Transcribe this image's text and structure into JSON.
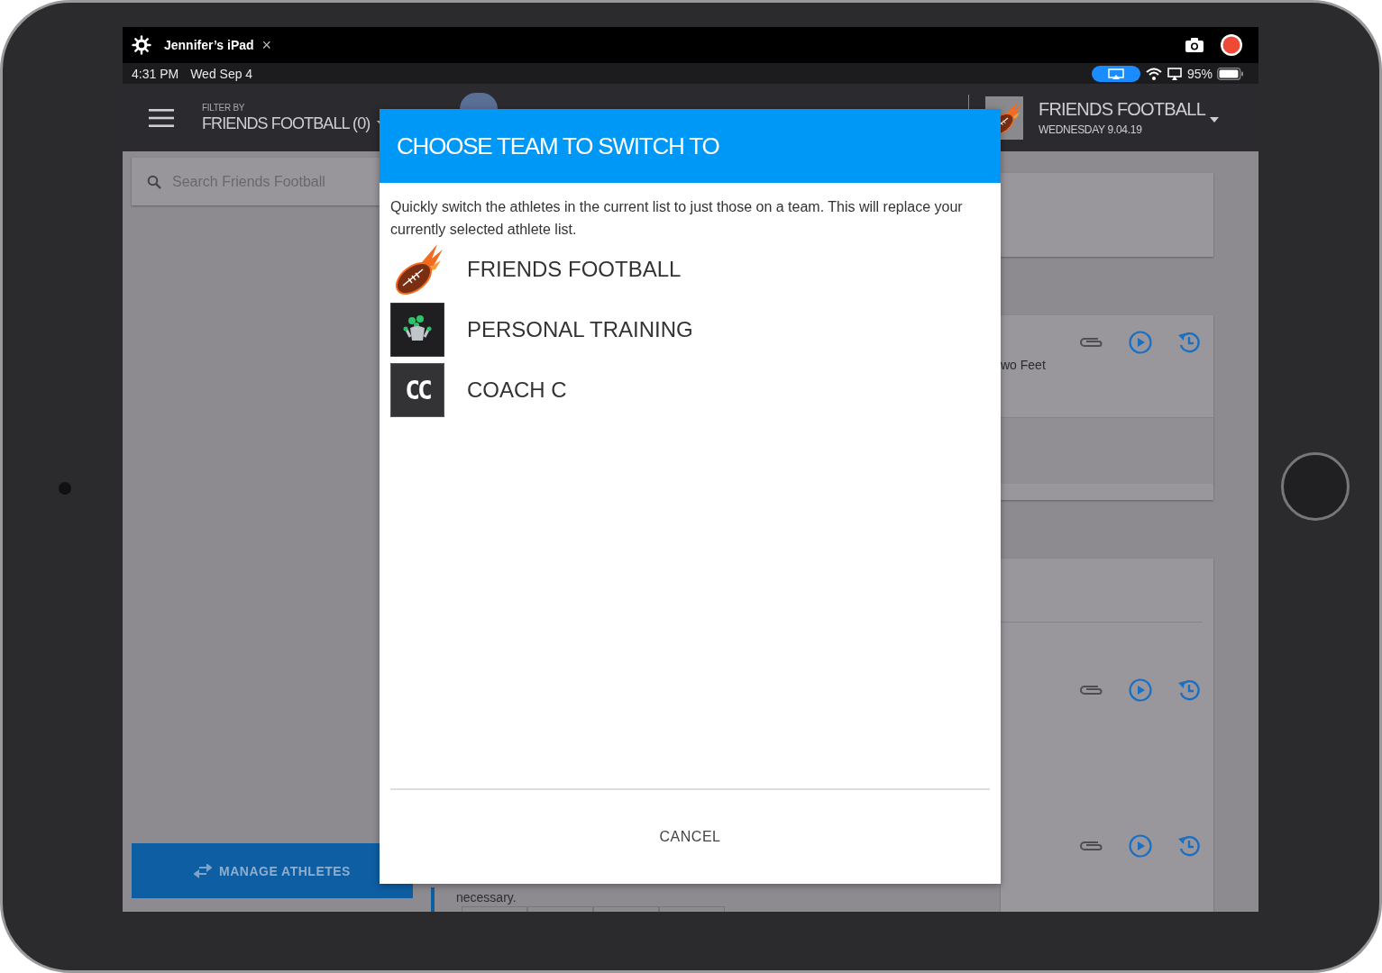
{
  "mirror_bar": {
    "device_name": "Jennifer’s iPad",
    "close": "×"
  },
  "status_bar": {
    "time": "4:31 PM",
    "date": "Wed Sep 4",
    "battery": "95%"
  },
  "app_header": {
    "filter_label": "FILTER BY",
    "filter_value": "FRIENDS FOOTBALL (0)",
    "team_name": "FRIENDS FOOTBALL",
    "date": "WEDNESDAY 9.04.19"
  },
  "sidebar": {
    "search": {
      "placeholder": "Search Friends Football"
    },
    "manage_button": "MANAGE ATHLETES"
  },
  "content": {
    "note": "necessary.",
    "cards": [
      {
        "kind": "blank"
      },
      {
        "kind": "exercise",
        "text": "wo Feet"
      },
      {
        "kind": "exercise_group"
      }
    ]
  },
  "dialog": {
    "title": "CHOOSE TEAM TO SWITCH TO",
    "description": "Quickly switch the athletes in the current list to just those on a team. This will replace your currently selected athlete list.",
    "teams": [
      {
        "kind": "football",
        "name": "FRIENDS FOOTBALL"
      },
      {
        "kind": "mascot",
        "name": "PERSONAL TRAINING"
      },
      {
        "kind": "initials",
        "initials": "CC",
        "name": "COACH C"
      }
    ],
    "cancel": "CANCEL"
  }
}
